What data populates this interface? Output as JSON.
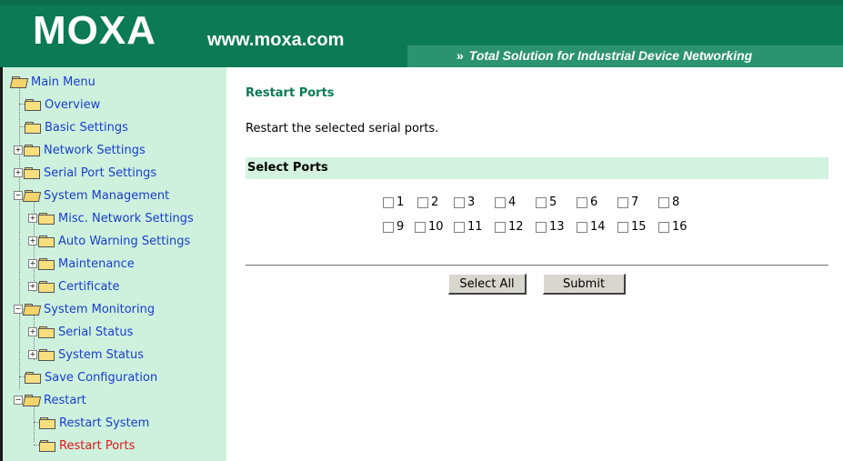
{
  "header": {
    "logo": "MOXA",
    "site": "www.moxa.com",
    "slogan_arrows": "»",
    "slogan": "Total Solution for Industrial Device Networking",
    "colors": {
      "header_bg": "#0b7a55",
      "slogan_bg": "#2c9370"
    }
  },
  "sidebar": {
    "items": [
      {
        "label": "Main Menu",
        "icon": "folder-open-icon"
      },
      {
        "label": "Overview",
        "icon": "folder-icon"
      },
      {
        "label": "Basic Settings",
        "icon": "folder-icon"
      },
      {
        "label": "Network Settings",
        "icon": "folder-icon",
        "expander": "+"
      },
      {
        "label": "Serial Port Settings",
        "icon": "folder-icon",
        "expander": "+"
      },
      {
        "label": "System Management",
        "icon": "folder-open-icon",
        "expander": "-"
      },
      {
        "label": "Misc. Network Settings",
        "icon": "folder-icon",
        "expander": "+"
      },
      {
        "label": "Auto Warning Settings",
        "icon": "folder-icon",
        "expander": "+"
      },
      {
        "label": "Maintenance",
        "icon": "folder-icon",
        "expander": "+"
      },
      {
        "label": "Certificate",
        "icon": "folder-icon",
        "expander": "+"
      },
      {
        "label": "System Monitoring",
        "icon": "folder-open-icon",
        "expander": "-"
      },
      {
        "label": "Serial Status",
        "icon": "folder-icon",
        "expander": "+"
      },
      {
        "label": "System Status",
        "icon": "folder-icon",
        "expander": "+"
      },
      {
        "label": "Save Configuration",
        "icon": "folder-icon"
      },
      {
        "label": "Restart",
        "icon": "folder-open-icon",
        "expander": "-"
      },
      {
        "label": "Restart System",
        "icon": "folder-icon"
      },
      {
        "label": "Restart Ports",
        "icon": "folder-icon",
        "active": true
      }
    ]
  },
  "main": {
    "title": "Restart Ports",
    "description": "Restart the selected serial ports.",
    "section_header": "Select Ports",
    "ports": [
      "1",
      "2",
      "3",
      "4",
      "5",
      "6",
      "7",
      "8",
      "9",
      "10",
      "11",
      "12",
      "13",
      "14",
      "15",
      "16"
    ],
    "select_all_label": "Select All",
    "submit_label": "Submit"
  }
}
